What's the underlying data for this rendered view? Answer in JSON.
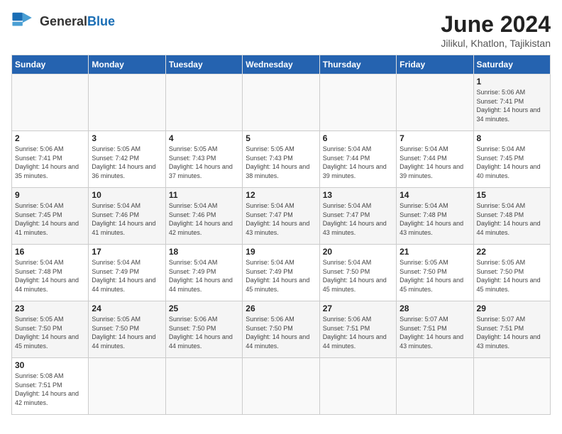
{
  "logo": {
    "text_general": "General",
    "text_blue": "Blue"
  },
  "title": "June 2024",
  "subtitle": "Jilikul, Khatlon, Tajikistan",
  "days_of_week": [
    "Sunday",
    "Monday",
    "Tuesday",
    "Wednesday",
    "Thursday",
    "Friday",
    "Saturday"
  ],
  "weeks": [
    [
      {
        "day": null,
        "info": null
      },
      {
        "day": null,
        "info": null
      },
      {
        "day": null,
        "info": null
      },
      {
        "day": null,
        "info": null
      },
      {
        "day": null,
        "info": null
      },
      {
        "day": null,
        "info": null
      },
      {
        "day": "1",
        "info": "Sunrise: 5:06 AM\nSunset: 7:41 PM\nDaylight: 14 hours and 34 minutes."
      }
    ],
    [
      {
        "day": "2",
        "info": "Sunrise: 5:06 AM\nSunset: 7:41 PM\nDaylight: 14 hours and 35 minutes."
      },
      {
        "day": "3",
        "info": "Sunrise: 5:05 AM\nSunset: 7:42 PM\nDaylight: 14 hours and 36 minutes."
      },
      {
        "day": "4",
        "info": "Sunrise: 5:05 AM\nSunset: 7:43 PM\nDaylight: 14 hours and 37 minutes."
      },
      {
        "day": "5",
        "info": "Sunrise: 5:05 AM\nSunset: 7:43 PM\nDaylight: 14 hours and 38 minutes."
      },
      {
        "day": "6",
        "info": "Sunrise: 5:04 AM\nSunset: 7:44 PM\nDaylight: 14 hours and 39 minutes."
      },
      {
        "day": "7",
        "info": "Sunrise: 5:04 AM\nSunset: 7:44 PM\nDaylight: 14 hours and 39 minutes."
      },
      {
        "day": "8",
        "info": "Sunrise: 5:04 AM\nSunset: 7:45 PM\nDaylight: 14 hours and 40 minutes."
      }
    ],
    [
      {
        "day": "9",
        "info": "Sunrise: 5:04 AM\nSunset: 7:45 PM\nDaylight: 14 hours and 41 minutes."
      },
      {
        "day": "10",
        "info": "Sunrise: 5:04 AM\nSunset: 7:46 PM\nDaylight: 14 hours and 41 minutes."
      },
      {
        "day": "11",
        "info": "Sunrise: 5:04 AM\nSunset: 7:46 PM\nDaylight: 14 hours and 42 minutes."
      },
      {
        "day": "12",
        "info": "Sunrise: 5:04 AM\nSunset: 7:47 PM\nDaylight: 14 hours and 43 minutes."
      },
      {
        "day": "13",
        "info": "Sunrise: 5:04 AM\nSunset: 7:47 PM\nDaylight: 14 hours and 43 minutes."
      },
      {
        "day": "14",
        "info": "Sunrise: 5:04 AM\nSunset: 7:48 PM\nDaylight: 14 hours and 43 minutes."
      },
      {
        "day": "15",
        "info": "Sunrise: 5:04 AM\nSunset: 7:48 PM\nDaylight: 14 hours and 44 minutes."
      }
    ],
    [
      {
        "day": "16",
        "info": "Sunrise: 5:04 AM\nSunset: 7:48 PM\nDaylight: 14 hours and 44 minutes."
      },
      {
        "day": "17",
        "info": "Sunrise: 5:04 AM\nSunset: 7:49 PM\nDaylight: 14 hours and 44 minutes."
      },
      {
        "day": "18",
        "info": "Sunrise: 5:04 AM\nSunset: 7:49 PM\nDaylight: 14 hours and 44 minutes."
      },
      {
        "day": "19",
        "info": "Sunrise: 5:04 AM\nSunset: 7:49 PM\nDaylight: 14 hours and 45 minutes."
      },
      {
        "day": "20",
        "info": "Sunrise: 5:04 AM\nSunset: 7:50 PM\nDaylight: 14 hours and 45 minutes."
      },
      {
        "day": "21",
        "info": "Sunrise: 5:05 AM\nSunset: 7:50 PM\nDaylight: 14 hours and 45 minutes."
      },
      {
        "day": "22",
        "info": "Sunrise: 5:05 AM\nSunset: 7:50 PM\nDaylight: 14 hours and 45 minutes."
      }
    ],
    [
      {
        "day": "23",
        "info": "Sunrise: 5:05 AM\nSunset: 7:50 PM\nDaylight: 14 hours and 45 minutes."
      },
      {
        "day": "24",
        "info": "Sunrise: 5:05 AM\nSunset: 7:50 PM\nDaylight: 14 hours and 44 minutes."
      },
      {
        "day": "25",
        "info": "Sunrise: 5:06 AM\nSunset: 7:50 PM\nDaylight: 14 hours and 44 minutes."
      },
      {
        "day": "26",
        "info": "Sunrise: 5:06 AM\nSunset: 7:50 PM\nDaylight: 14 hours and 44 minutes."
      },
      {
        "day": "27",
        "info": "Sunrise: 5:06 AM\nSunset: 7:51 PM\nDaylight: 14 hours and 44 minutes."
      },
      {
        "day": "28",
        "info": "Sunrise: 5:07 AM\nSunset: 7:51 PM\nDaylight: 14 hours and 43 minutes."
      },
      {
        "day": "29",
        "info": "Sunrise: 5:07 AM\nSunset: 7:51 PM\nDaylight: 14 hours and 43 minutes."
      }
    ],
    [
      {
        "day": "30",
        "info": "Sunrise: 5:08 AM\nSunset: 7:51 PM\nDaylight: 14 hours and 42 minutes."
      },
      {
        "day": null,
        "info": null
      },
      {
        "day": null,
        "info": null
      },
      {
        "day": null,
        "info": null
      },
      {
        "day": null,
        "info": null
      },
      {
        "day": null,
        "info": null
      },
      {
        "day": null,
        "info": null
      }
    ]
  ]
}
